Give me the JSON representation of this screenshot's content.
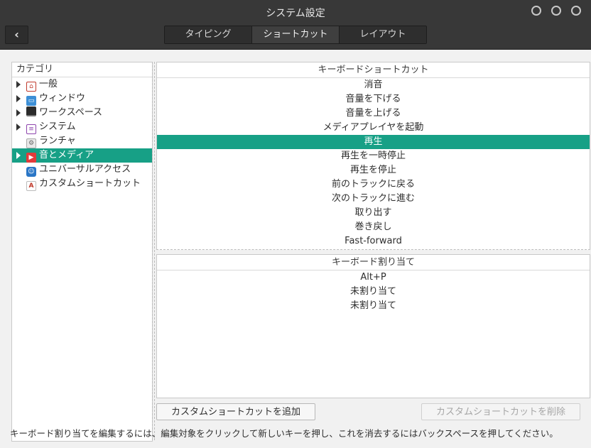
{
  "window": {
    "title": "システム設定",
    "back_label": "‹",
    "controls": [
      "minimize",
      "maximize",
      "close"
    ]
  },
  "tabs": [
    {
      "label": "タイピング",
      "active": false
    },
    {
      "label": "ショートカット",
      "active": true
    },
    {
      "label": "レイアウト",
      "active": false
    }
  ],
  "categories": {
    "header": "カテゴリ",
    "items": [
      {
        "label": "一般",
        "icon": "general-icon",
        "expandable": true,
        "selected": false
      },
      {
        "label": "ウィンドウ",
        "icon": "window-icon",
        "expandable": true,
        "selected": false
      },
      {
        "label": "ワークスペース",
        "icon": "workspace-icon",
        "expandable": true,
        "selected": false
      },
      {
        "label": "システム",
        "icon": "system-icon",
        "expandable": true,
        "selected": false
      },
      {
        "label": "ランチャ",
        "icon": "launcher-icon",
        "expandable": false,
        "selected": false
      },
      {
        "label": "音とメディア",
        "icon": "media-icon",
        "expandable": true,
        "selected": true
      },
      {
        "label": "ユニバーサルアクセス",
        "icon": "accessibility-icon",
        "expandable": false,
        "selected": false
      },
      {
        "label": "カスタムショートカット",
        "icon": "custom-shortcut-icon",
        "expandable": false,
        "selected": false
      }
    ]
  },
  "shortcuts": {
    "header": "キーボードショートカット",
    "items": [
      {
        "label": "消音",
        "selected": false
      },
      {
        "label": "音量を下げる",
        "selected": false
      },
      {
        "label": "音量を上げる",
        "selected": false
      },
      {
        "label": "メディアプレイヤを起動",
        "selected": false
      },
      {
        "label": "再生",
        "selected": true
      },
      {
        "label": "再生を一時停止",
        "selected": false
      },
      {
        "label": "再生を停止",
        "selected": false
      },
      {
        "label": "前のトラックに戻る",
        "selected": false
      },
      {
        "label": "次のトラックに進む",
        "selected": false
      },
      {
        "label": "取り出す",
        "selected": false
      },
      {
        "label": "巻き戻し",
        "selected": false
      },
      {
        "label": "Fast-forward",
        "selected": false
      }
    ]
  },
  "bindings": {
    "header": "キーボード割り当て",
    "items": [
      "Alt+P",
      "未割り当て",
      "未割り当て"
    ]
  },
  "buttons": {
    "add_label": "カスタムショートカットを追加",
    "remove_label": "カスタムショートカットを削除"
  },
  "hint": "キーボード割り当てを編集するには、編集対象をクリックして新しいキーを押し、これを消去するにはバックスペースを押してください。",
  "colors": {
    "accent": "#17a086",
    "headerbar": "#383838"
  }
}
